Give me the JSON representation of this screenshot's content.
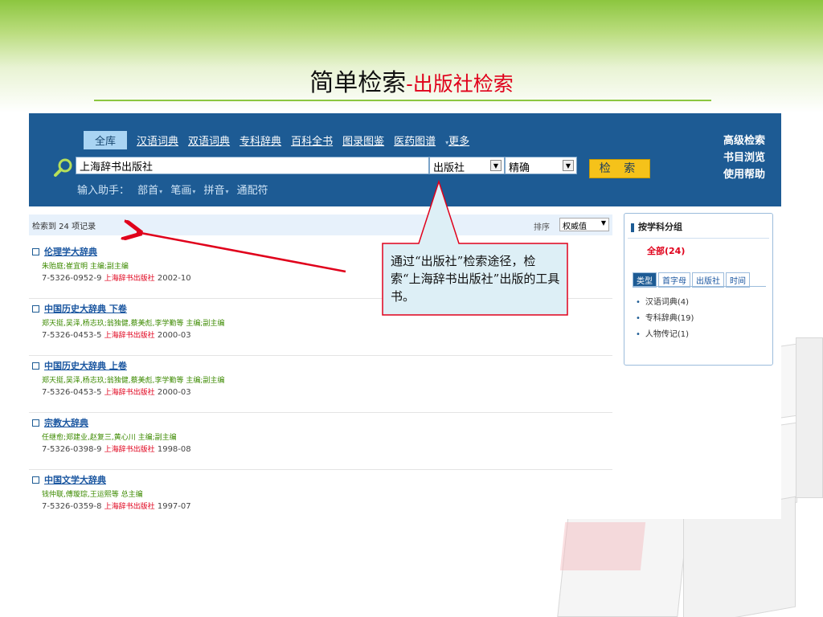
{
  "slide": {
    "title_main": "简单检索",
    "title_sub": "-出版社检索"
  },
  "header": {
    "tabs": [
      "全库",
      "汉语词典",
      "双语词典",
      "专科辞典",
      "百科全书",
      "图录图鉴",
      "医药图谱"
    ],
    "more_label": "更多",
    "right_links": [
      "高级检索",
      "书目浏览",
      "使用帮助"
    ],
    "search_value": "上海辞书出版社",
    "field_select": "出版社",
    "match_select": "精确",
    "search_button": "检 索",
    "helper_label": "输入助手：",
    "helper_items": [
      "部首",
      "笔画",
      "拼音",
      "通配符"
    ]
  },
  "results": {
    "count_text": "检索到 24 项记录",
    "sort_label": "排序",
    "sort_value": "权威值",
    "records": [
      {
        "title": "伦理学大辞典",
        "authors": "朱贻庭;崔宜明 主编;副主编",
        "isbn": "7-5326-0952-9",
        "publisher": "上海辞书出版社",
        "date": "2002-10"
      },
      {
        "title": "中国历史大辞典 下卷",
        "authors": "郑天挺,吴泽,杨志玖;翁独健,蔡美彪,李学勤等 主编;副主编",
        "isbn": "7-5326-0453-5",
        "publisher": "上海辞书出版社",
        "date": "2000-03"
      },
      {
        "title": "中国历史大辞典 上卷",
        "authors": "郑天挺,吴泽,杨志玖;翁独健,蔡美彪,李学勤等 主编;副主编",
        "isbn": "7-5326-0453-5",
        "publisher": "上海辞书出版社",
        "date": "2000-03"
      },
      {
        "title": "宗教大辞典",
        "authors": "任继愈;郑建业,赵复三,黄心川 主编;副主编",
        "isbn": "7-5326-0398-9",
        "publisher": "上海辞书出版社",
        "date": "1998-08"
      },
      {
        "title": "中国文学大辞典",
        "authors": "钱仲联,傅璇琮,王运熙等 总主编",
        "isbn": "7-5326-0359-8",
        "publisher": "上海辞书出版社",
        "date": "1997-07"
      }
    ]
  },
  "facet": {
    "title": "按学科分组",
    "all": "全部(24)",
    "tabs": [
      "类型",
      "首字母",
      "出版社",
      "时间"
    ],
    "items": [
      "汉语词典(4)",
      "专科辞典(19)",
      "人物传记(1)"
    ]
  },
  "callout": {
    "text": "通过“出版社”检索途径，检索“上海辞书出版社”出版的工具书。"
  }
}
